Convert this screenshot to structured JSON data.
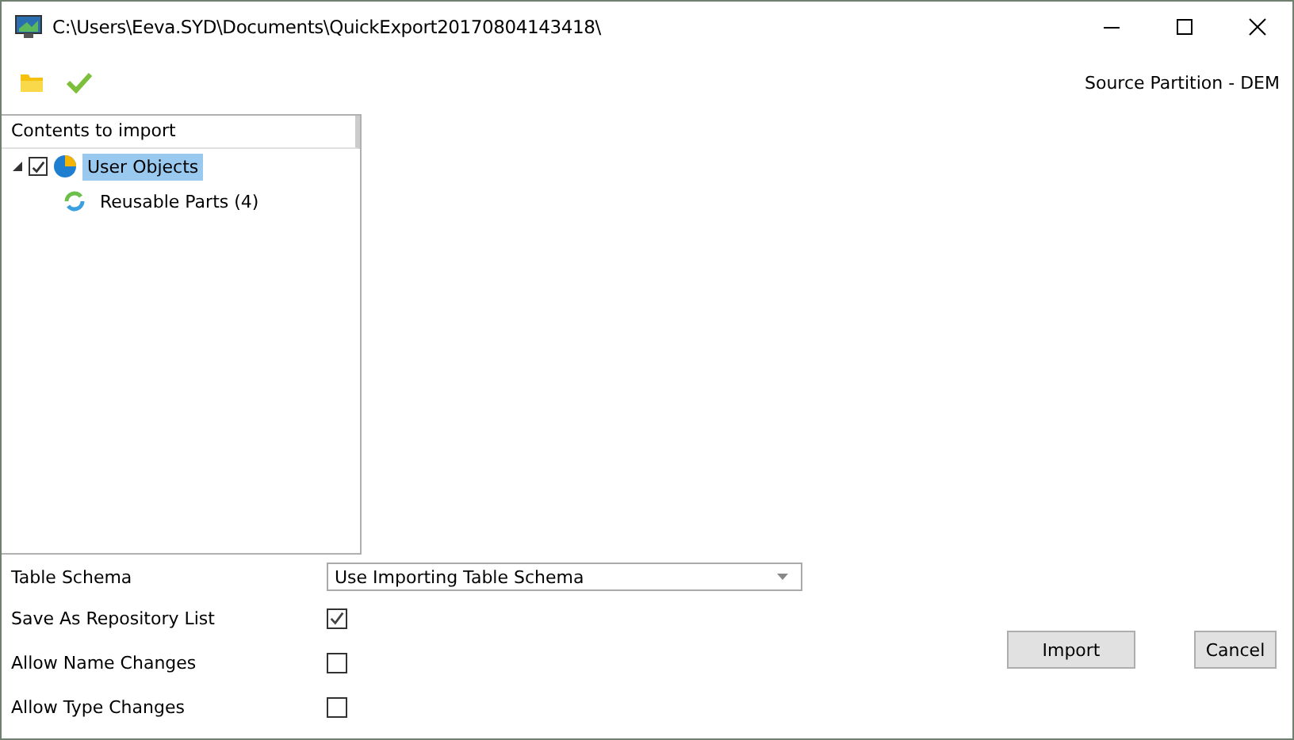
{
  "window": {
    "title": "C:\\Users\\Eeva.SYD\\Documents\\QuickExport20170804143418\\"
  },
  "toolbar": {
    "source_label": "Source Partition - DEM"
  },
  "tree": {
    "header": "Contents to import",
    "items": [
      {
        "label": "User Objects",
        "checked": true,
        "selected": true,
        "expanded": true,
        "children": [
          {
            "label": "Reusable Parts (4)",
            "selected": false
          }
        ]
      }
    ]
  },
  "options": [
    {
      "kind": "dropdown",
      "label": "Table Schema",
      "value": "Use Importing Table Schema"
    },
    {
      "kind": "checkbox",
      "label": "Save As Repository List",
      "checked": true
    },
    {
      "kind": "checkbox",
      "label": "Allow Name Changes",
      "checked": false
    },
    {
      "kind": "checkbox",
      "label": "Allow Type Changes",
      "checked": false
    }
  ],
  "buttons": [
    "Import",
    "Cancel"
  ]
}
